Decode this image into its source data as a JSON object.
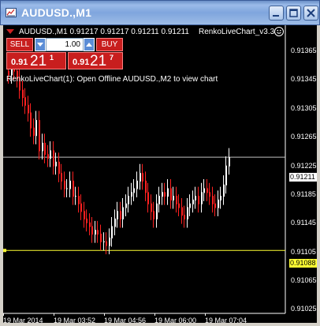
{
  "window": {
    "title": "AUDUSD.,M1",
    "icon": "chart-window-icon",
    "controls": [
      "minimize-icon",
      "maximize-icon",
      "close-icon"
    ]
  },
  "chart": {
    "header_info": "AUDUSD.,M1  0.91217 0.91217 0.91211 0.91211",
    "indicator_name": "RenkoLiveChart_v3.3",
    "notice": "RenkoLiveChart(1): Open Offline AUDUSD.,M2 to view chart",
    "colors": {
      "background": "#000000",
      "bull_candle": "#ffffff",
      "bear_candle": "#ff2020",
      "bid_line": "#c0c0c0",
      "low_line": "#ffff33",
      "trade_button": "#c81e1e"
    }
  },
  "trade_panel": {
    "sell_label": "SELL",
    "buy_label": "BUY",
    "lot_value": "1.00",
    "sell_price": {
      "small": "0.91",
      "big": "21",
      "sup": "1"
    },
    "buy_price": {
      "small": "0.91",
      "big": "21",
      "sup": "7"
    }
  },
  "price_axis": {
    "labels": [
      "0.91365",
      "0.91345",
      "0.91305",
      "0.91265",
      "0.91225",
      "0.91185",
      "0.91145",
      "0.91105",
      "0.91065",
      "0.91025"
    ],
    "bid_tag": "0.91211",
    "low_tag": "0.91088"
  },
  "time_axis": {
    "labels": [
      "19 Mar 2014",
      "19 Mar 03:52",
      "19 Mar 04:56",
      "19 Mar 06:00",
      "19 Mar 07:04"
    ]
  },
  "chart_data": {
    "type": "candlestick",
    "symbol": "AUDUSD.",
    "timeframe": "M1",
    "bid": 0.91211,
    "low_line": 0.91088,
    "ylim": [
      0.91005,
      0.91385
    ],
    "series": [
      {
        "values": [
          0.9132,
          0.9133,
          0.91325,
          0.91315,
          0.913,
          0.9129,
          0.9128,
          0.9127,
          0.9125,
          0.9124,
          0.9126,
          0.9122,
          0.9123,
          0.91215,
          0.9121,
          0.9122,
          0.912,
          0.91205,
          0.9119,
          0.9118,
          0.9117,
          0.9117,
          0.9118,
          0.9116,
          0.9116,
          0.9115,
          0.9114,
          0.9113,
          0.91125,
          0.9112,
          0.9111,
          0.91115,
          0.9111,
          0.911,
          0.911,
          0.91095,
          0.91105,
          0.9112,
          0.9113,
          0.9114,
          0.9113,
          0.91145,
          0.9115,
          0.9116,
          0.91165,
          0.9117,
          0.9118,
          0.9119,
          0.9118,
          0.91165,
          0.9115,
          0.9114,
          0.9113,
          0.9115,
          0.9116,
          0.91165,
          0.9116,
          0.9117,
          0.91155,
          0.9116,
          0.9115,
          0.91145,
          0.91135,
          0.9113,
          0.91145,
          0.9115,
          0.91155,
          0.9116,
          0.9115,
          0.91165,
          0.9117,
          0.91165,
          0.9116,
          0.9115,
          0.91145,
          0.91155,
          0.9116,
          0.91175,
          0.912,
          0.91211
        ]
      }
    ]
  }
}
